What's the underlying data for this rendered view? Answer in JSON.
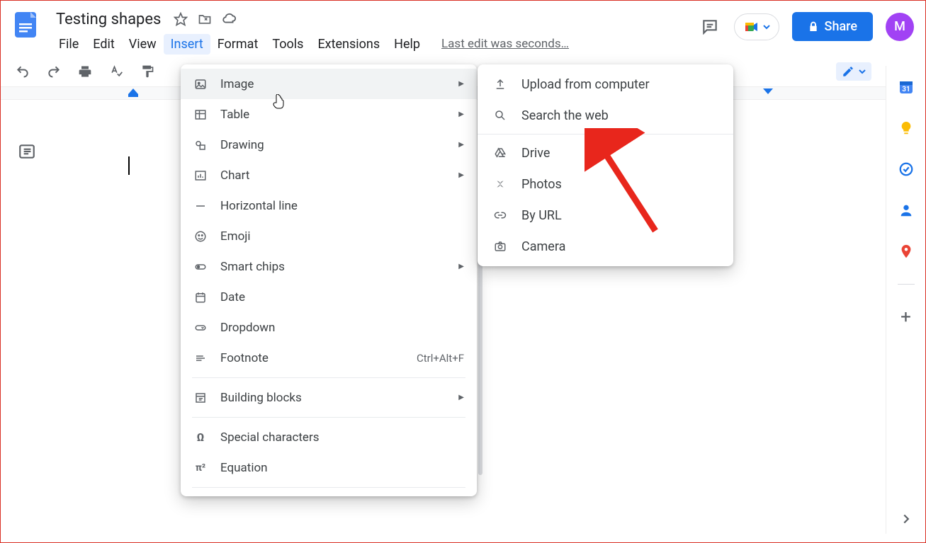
{
  "doc": {
    "title": "Testing shapes",
    "last_edit": "Last edit was seconds…"
  },
  "menubar": {
    "file": "File",
    "edit": "Edit",
    "view": "View",
    "insert": "Insert",
    "format": "Format",
    "tools": "Tools",
    "extensions": "Extensions",
    "help": "Help"
  },
  "header": {
    "share": "Share",
    "avatar_initial": "M"
  },
  "insert_menu": {
    "image": "Image",
    "table": "Table",
    "drawing": "Drawing",
    "chart": "Chart",
    "hr": "Horizontal line",
    "emoji": "Emoji",
    "smart": "Smart chips",
    "date": "Date",
    "dropdown": "Dropdown",
    "footnote": "Footnote",
    "footnote_sc": "Ctrl+Alt+F",
    "building": "Building blocks",
    "special": "Special characters",
    "equation": "Equation"
  },
  "image_submenu": {
    "upload": "Upload from computer",
    "search": "Search the web",
    "drive": "Drive",
    "photos": "Photos",
    "byurl": "By URL",
    "camera": "Camera"
  }
}
